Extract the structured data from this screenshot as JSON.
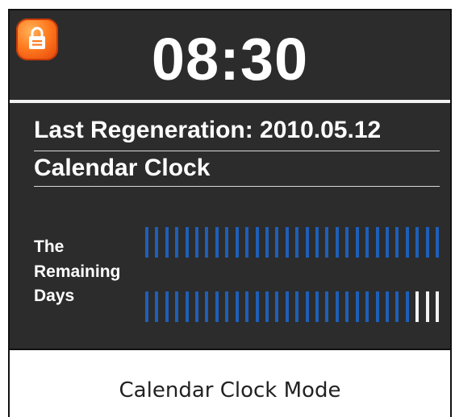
{
  "display": {
    "time": "08:30",
    "last_regeneration": "Last Regeneration: 2010.05.12",
    "mode": "Calendar Clock",
    "remaining_label": [
      "The",
      "Remaining",
      "Days"
    ],
    "lock_icon": "lock-icon"
  },
  "remaining_days": {
    "row1": {
      "segments": 30,
      "filled": 30
    },
    "row2": {
      "segments": 30,
      "filled": 27
    }
  },
  "caption": "Calendar Clock Mode",
  "colors": {
    "screen_bg": "#2c2c2c",
    "text": "#ffffff",
    "bar_filled": "#1e5fb8",
    "bar_empty": "#f2f2f2",
    "lock_badge": "#ff7a1e"
  }
}
